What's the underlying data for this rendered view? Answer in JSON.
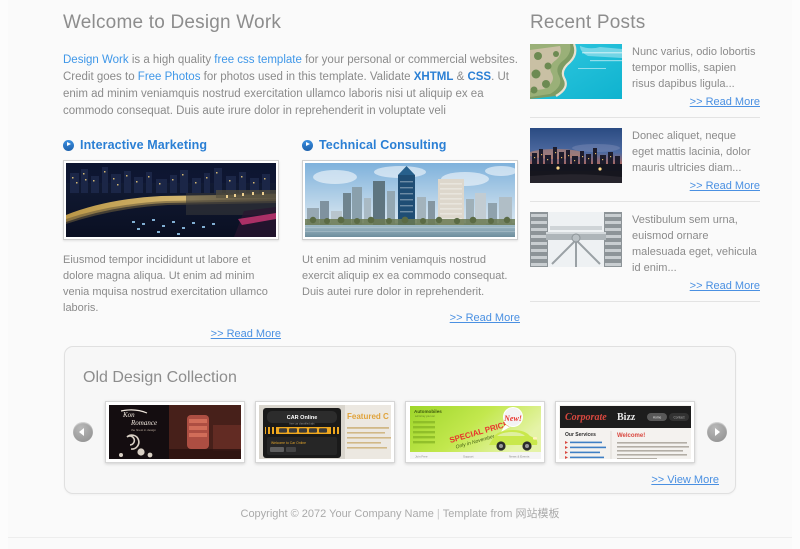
{
  "main": {
    "title": "Welcome to Design Work",
    "intro": {
      "link1": "Design Work",
      "t1": " is a high quality ",
      "link2": "free css template",
      "t2": " for your personal or commercial websites. Credit goes to ",
      "link3": "Free Photos",
      "t3": " for photos used in this template. Validate ",
      "b1": "XHTML",
      "t4": " & ",
      "b2": "CSS",
      "t5": ". Ut enim ad minim veniamquis nostrud exercitation ullamco laboris nisi ut aliquip ex ea commodo consequat. Duis aute irure dolor in reprehenderit in voluptate veli"
    },
    "features": [
      {
        "title": "Interactive Marketing",
        "icon": "circle-arrow-icon",
        "image_name": "city-bridge-night-photo",
        "text": "Eiusmod tempor incididunt ut labore et dolore magna aliqua. Ut enim ad minim venia mquisa nostrud exercitation ullamco laboris.",
        "read_more": ">> Read More"
      },
      {
        "title": "Technical Consulting",
        "icon": "circle-arrow-icon",
        "image_name": "city-skyline-daytime-photo",
        "text": "Ut enim ad minim veniamquis nostrud exercit aliquip ex ea commodo consequat. Duis autei rure dolor in reprehenderit.",
        "read_more": ">> Read More"
      }
    ]
  },
  "sidebar": {
    "title": "Recent Posts",
    "posts": [
      {
        "thumb_name": "beach-coastline-thumb",
        "text": "Nunc varius, odio lobortis tempor mollis, sapien risus dapibus ligula...",
        "read_more": ">> Read More"
      },
      {
        "thumb_name": "city-sunset-skyline-thumb",
        "text": "Donec aliquet, neque eget mattis lacinia, dolor mauris ultricies diam...",
        "read_more": ">> Read More"
      },
      {
        "thumb_name": "steel-structure-thumb",
        "text": "Vestibulum sem urna, euismod ornare malesuada eget, vehicula id enim...",
        "read_more": ">> Read More"
      }
    ]
  },
  "collection": {
    "title": "Old Design Collection",
    "prev_icon": "arrow-left-icon",
    "next_icon": "arrow-right-icon",
    "slides": [
      {
        "name": "dark-interior-design-slide",
        "caption": "Kon Romance"
      },
      {
        "name": "car-online-slide",
        "caption": "CAR Online"
      },
      {
        "name": "automobiles-green-slide",
        "caption": "Automobiles"
      },
      {
        "name": "corporate-bizz-slide",
        "caption": "Corporate Bizz"
      }
    ],
    "view_more": ">> View More"
  },
  "footer": {
    "copyright": "Copyright © 2072 Your Company Name",
    "separator": "|",
    "template_from": "Template from 网站模板"
  },
  "colors": {
    "link": "#4a90e2",
    "heading": "#2a7fd4",
    "text": "#8b8b8b",
    "title": "#8d8d8d",
    "background": "#fafafa"
  }
}
